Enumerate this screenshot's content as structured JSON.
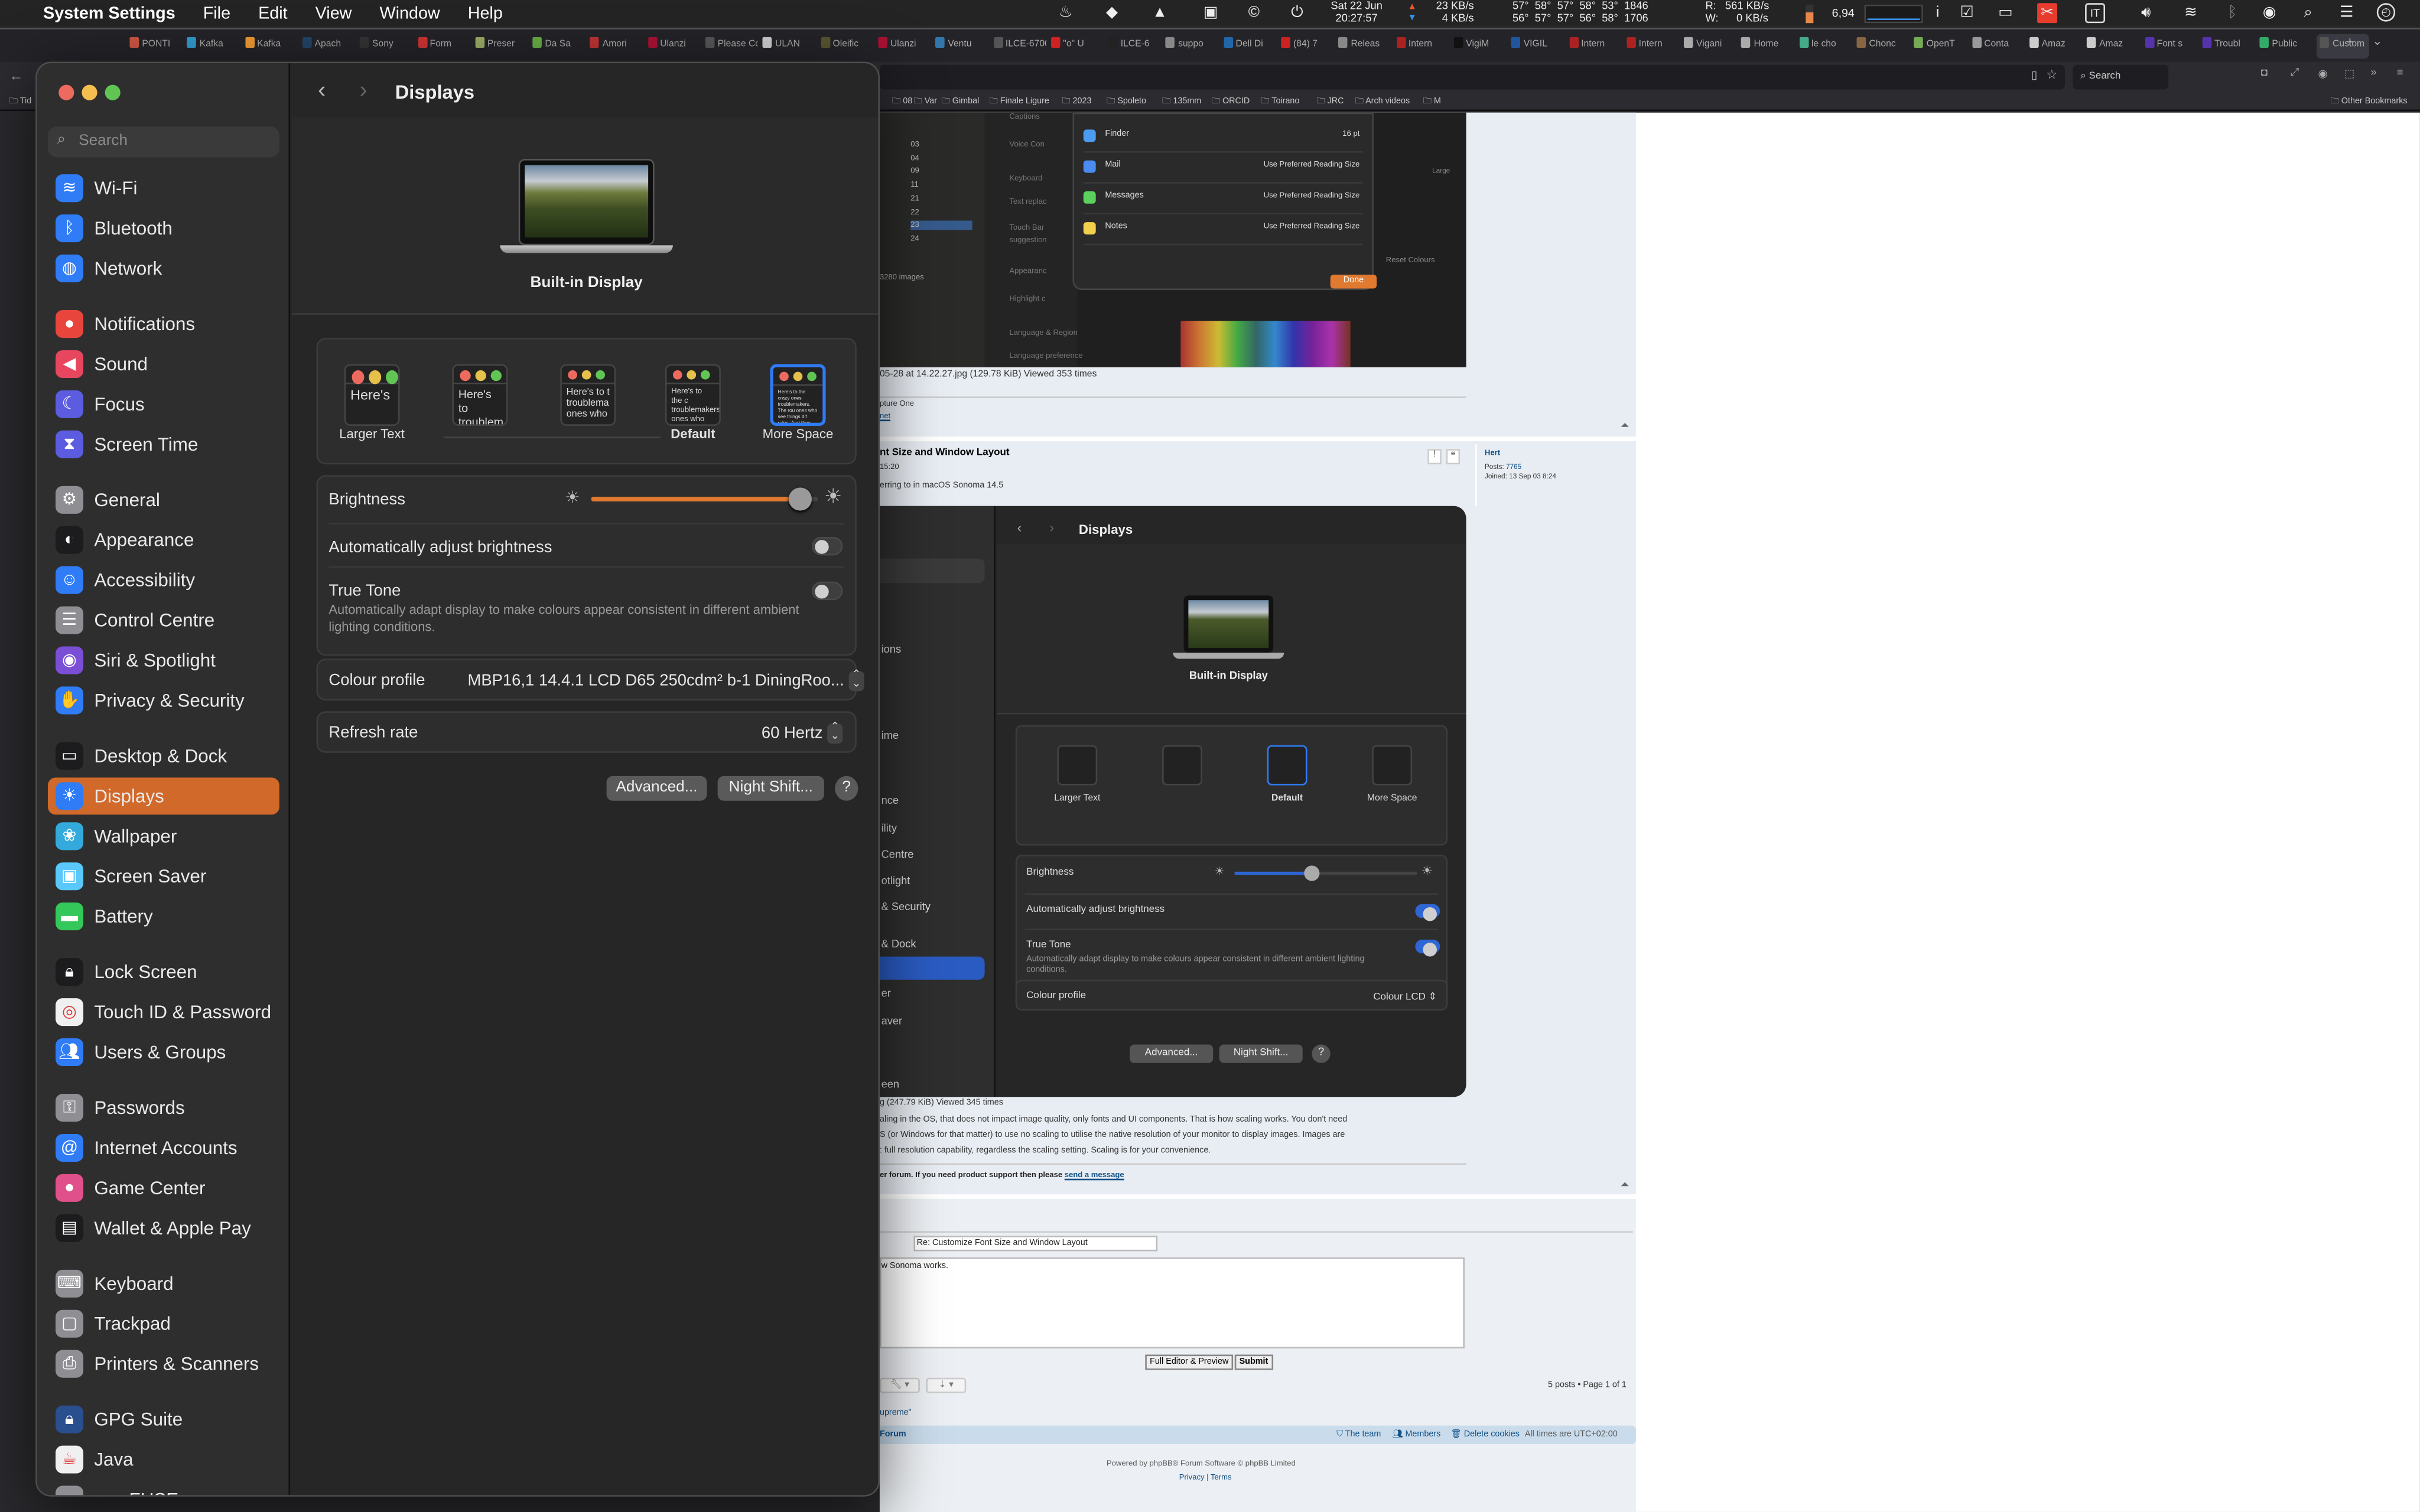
{
  "menubar": {
    "app_name": "System Settings",
    "menus": [
      "File",
      "Edit",
      "View",
      "Window",
      "Help"
    ],
    "date": "Sat 22 Jun",
    "time": "20:27:57",
    "net_up": "23 KB/s",
    "net_down": "4 KB/s",
    "temps_row1": "57°  58°  57°  58°  53°  1846",
    "temps_row2": "56°  57°  57°  56°  58°  1706",
    "disk_read": "R:   561 KB/s",
    "disk_write": "W:      0 KB/s",
    "load": "6,94",
    "keyboard_layout": "IT"
  },
  "browser": {
    "tabs": [
      "PONTI",
      "Kafka",
      "Kafka",
      "Apach",
      "Sony",
      "Form",
      "Preser",
      "Da Sa",
      "Amori",
      "Ulanzi",
      "Please Co",
      "ULAN",
      "Oleific",
      "Ulanzi",
      "Ventu",
      "ILCE-6700",
      "\"o\" U",
      "ILCE-6",
      "suppo",
      "Dell Di",
      "(84) 7",
      "Releas",
      "Intern",
      "VigiM",
      "VIGIL",
      "Intern",
      "Intern",
      "Vigani",
      "Home",
      "le cho",
      "Chonc",
      "OpenT",
      "Conta",
      "Amaz",
      "Amaz",
      "Font s",
      "Troubl",
      "Public",
      "Custom"
    ],
    "active_tab": "Custom",
    "search_placeholder": "Search",
    "bookmarks": [
      "Tid",
      "08",
      "Var",
      "Gimbal",
      "Finale Ligure",
      "2023",
      "Spoleto",
      "135mm",
      "ORCID",
      "Toirano",
      "JRC",
      "Arch videos",
      "M"
    ],
    "other_bookmarks": "Other Bookmarks"
  },
  "forum": {
    "shot1": {
      "rows": [
        {
          "app": "Finder",
          "value": "16 pt"
        },
        {
          "app": "Mail",
          "value": "Use Preferred Reading Size"
        },
        {
          "app": "Messages",
          "value": "Use Preferred Reading Size"
        },
        {
          "app": "Notes",
          "value": "Use Preferred Reading Size"
        }
      ],
      "done": "Done",
      "left_items": [
        "Captions",
        "Voice Con",
        "Keyboard",
        "Text replac",
        "Touch Bar",
        "suggestion",
        "Appearanc",
        "Highlight c",
        "Language & Region",
        "Language preference"
      ],
      "folders": [
        "03",
        "04",
        "09",
        "11",
        "21",
        "22",
        "23",
        "24"
      ],
      "images_count": "3280 images",
      "large_label": "Large",
      "reset_colours": "Reset Colours"
    },
    "attach1": "05-28 at 14.22.27.jpg (129.78 KiB) Viewed 353 times",
    "sig1": "pture One",
    "sig1_link": "net",
    "post2_title": "nt Size and Window Layout",
    "post2_time": "15:20",
    "post2_body": "erring to in macOS Sonoma 14.5",
    "author": "Hert",
    "posts_label": "Posts:",
    "posts_value": "7765",
    "joined_label": "Joined:",
    "joined_value": "13 Sep 03 8:24",
    "shot2": {
      "title": "Displays",
      "display_name": "Built-in Display",
      "sidebar_fragments": [
        "ions",
        "ime",
        "nce",
        "ility",
        "Centre",
        "otlight",
        "& Security",
        "& Dock",
        "er",
        "aver",
        "een"
      ],
      "options": [
        "Larger Text",
        "",
        "Default",
        "More Space"
      ],
      "brightness": "Brightness",
      "brightness_level": 0.42,
      "auto": "Automatically adjust brightness",
      "true_tone": "True Tone",
      "true_tone_desc": "Automatically adapt display to make colours appear consistent in different ambient lighting conditions.",
      "colour_profile": "Colour profile",
      "colour_profile_value": "Colour LCD",
      "advanced": "Advanced...",
      "night_shift": "Night Shift...",
      "help": "?"
    },
    "attach2": "g (247.79 KiB) Viewed 345 times",
    "body_lines": [
      "aling in the OS, that does not impact image quality, only fonts and UI components. That is how scaling works. You don't need",
      "S (or Windows for that matter) to use no scaling to utilise the native resolution of your monitor to display images. Images are",
      ": full resolution capability, regardless the scaling setting. Scaling is for your convenience."
    ],
    "notice": "er forum. If you need product support then please ",
    "notice_link": "send a message",
    "reply_subject": "Re: Customize Font Size and Window Layout",
    "reply_text": "w Sonoma works.",
    "full_editor": "Full Editor & Preview",
    "submit": "Submit",
    "pagination": "5 posts • Page 1 of 1",
    "supreme": "upreme\"",
    "footer_forum": "Forum",
    "team": "The team",
    "members": "Members",
    "delete_cookies": "Delete cookies",
    "timezone": "All times are UTC+02:00",
    "powered": "Powered by phpBB® Forum Software © phpBB Limited",
    "privacy": "Privacy",
    "terms": "Terms"
  },
  "settings": {
    "search_placeholder": "Search",
    "title": "Displays",
    "sidebar_groups": [
      [
        {
          "label": "Wi-Fi",
          "icon": "wifi-icon",
          "glyph": "≋",
          "color": "#2f7cf6"
        },
        {
          "label": "Bluetooth",
          "icon": "bluetooth-icon",
          "glyph": "ᛒ",
          "color": "#2f7cf6"
        },
        {
          "label": "Network",
          "icon": "globe-icon",
          "glyph": "◍",
          "color": "#2f7cf6"
        }
      ],
      [
        {
          "label": "Notifications",
          "icon": "bell-icon",
          "glyph": "●",
          "color": "#e8453c"
        },
        {
          "label": "Sound",
          "icon": "speaker-icon",
          "glyph": "◀",
          "color": "#e8455f"
        },
        {
          "label": "Focus",
          "icon": "moon-icon",
          "glyph": "☾",
          "color": "#5b5ce0"
        },
        {
          "label": "Screen Time",
          "icon": "hourglass-icon",
          "glyph": "⧗",
          "color": "#5b5ce0"
        }
      ],
      [
        {
          "label": "General",
          "icon": "gear-icon",
          "glyph": "⚙",
          "color": "#8e8e93"
        },
        {
          "label": "Appearance",
          "icon": "appearance-icon",
          "glyph": "◐",
          "color": "#1c1c1e"
        },
        {
          "label": "Accessibility",
          "icon": "accessibility-icon",
          "glyph": "☺",
          "color": "#2f7cf6"
        },
        {
          "label": "Control Centre",
          "icon": "control-centre-icon",
          "glyph": "☰",
          "color": "#8e8e93"
        },
        {
          "label": "Siri & Spotlight",
          "icon": "siri-icon",
          "glyph": "◉",
          "color": "#7a4fd6"
        },
        {
          "label": "Privacy & Security",
          "icon": "hand-icon",
          "glyph": "✋",
          "color": "#2f7cf6"
        }
      ],
      [
        {
          "label": "Desktop & Dock",
          "icon": "dock-icon",
          "glyph": "▭",
          "color": "#1c1c1e"
        },
        {
          "label": "Displays",
          "icon": "sun-icon",
          "glyph": "☀",
          "color": "#2f7cf6",
          "selected": true
        },
        {
          "label": "Wallpaper",
          "icon": "wallpaper-icon",
          "glyph": "❀",
          "color": "#34aadc"
        },
        {
          "label": "Screen Saver",
          "icon": "screensaver-icon",
          "glyph": "▣",
          "color": "#5ac8fa"
        },
        {
          "label": "Battery",
          "icon": "battery-icon",
          "glyph": "▬",
          "color": "#34c759"
        }
      ],
      [
        {
          "label": "Lock Screen",
          "icon": "lock-icon",
          "glyph": "🔒︎",
          "color": "#1c1c1e"
        },
        {
          "label": "Touch ID & Password",
          "icon": "fingerprint-icon",
          "glyph": "◎",
          "color": "#f0f0f0"
        },
        {
          "label": "Users & Groups",
          "icon": "users-icon",
          "glyph": "👥︎",
          "color": "#2f7cf6"
        }
      ],
      [
        {
          "label": "Passwords",
          "icon": "key-icon",
          "glyph": "⚿",
          "color": "#8e8e93"
        },
        {
          "label": "Internet Accounts",
          "icon": "at-icon",
          "glyph": "@",
          "color": "#2f7cf6"
        },
        {
          "label": "Game Center",
          "icon": "game-center-icon",
          "glyph": "●",
          "color": "#e0508a"
        },
        {
          "label": "Wallet & Apple Pay",
          "icon": "wallet-icon",
          "glyph": "▤",
          "color": "#1c1c1e"
        }
      ],
      [
        {
          "label": "Keyboard",
          "icon": "keyboard-icon",
          "glyph": "⌨",
          "color": "#8e8e93"
        },
        {
          "label": "Trackpad",
          "icon": "trackpad-icon",
          "glyph": "▢",
          "color": "#8e8e93"
        },
        {
          "label": "Printers & Scanners",
          "icon": "printer-icon",
          "glyph": "⎙",
          "color": "#8e8e93"
        }
      ],
      [
        {
          "label": "GPG Suite",
          "icon": "gpg-icon",
          "glyph": "🔒︎",
          "color": "#2a4f8f"
        },
        {
          "label": "Java",
          "icon": "java-icon",
          "glyph": "☕︎",
          "color": "#f0f0f0"
        },
        {
          "label": "macFUSE",
          "icon": "macfuse-icon",
          "glyph": "▪",
          "color": "#8e8e93"
        }
      ]
    ],
    "display_name": "Built-in Display",
    "resolution_options": [
      {
        "label": "Larger Text",
        "sample": "Here's"
      },
      {
        "label": "",
        "sample": "Here's to troublem"
      },
      {
        "label": "",
        "sample": "Here's to t troublema ones who"
      },
      {
        "label": "Default",
        "sample": "Here's to the c troublemakers. ones who see t rules. And they"
      },
      {
        "label": "More Space",
        "sample": "Here's to the crazy ones troublemakers. The rou ones who see things dif rules. And they have no can quote them, disagr them. About the only th Because they change th",
        "selected": true
      }
    ],
    "brightness_label": "Brightness",
    "brightness_level": 0.92,
    "auto_brightness_label": "Automatically adjust brightness",
    "auto_brightness_on": false,
    "true_tone_label": "True Tone",
    "true_tone_desc": "Automatically adapt display to make colours appear consistent in different ambient lighting conditions.",
    "true_tone_on": false,
    "colour_profile_label": "Colour profile",
    "colour_profile_value": "MBP16,1 14.4.1 LCD D65 250cdm² b-1 DiningRoo...",
    "refresh_rate_label": "Refresh rate",
    "refresh_rate_value": "60 Hertz",
    "advanced_label": "Advanced...",
    "night_shift_label": "Night Shift...",
    "help_label": "?",
    "accent_color": "#d1692a",
    "slider_color": "#e07a30"
  }
}
